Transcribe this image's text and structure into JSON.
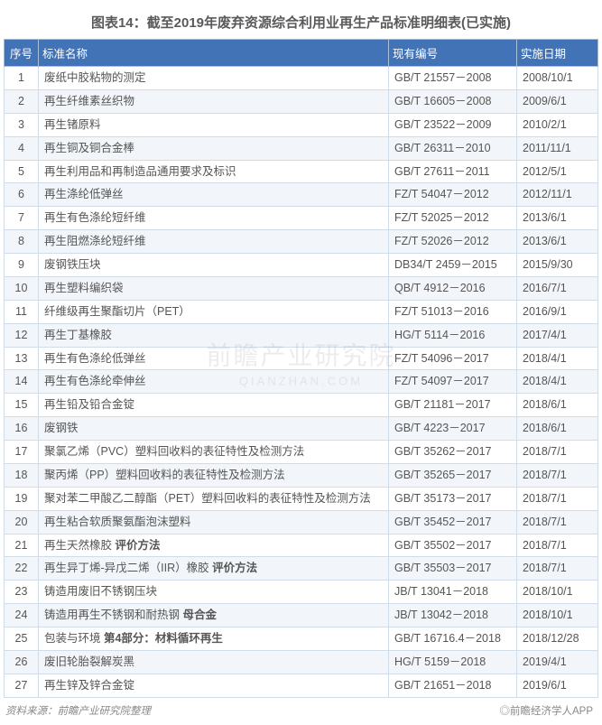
{
  "chart_data": {
    "type": "table",
    "title": "图表14：截至2019年废弃资源综合利用业再生产品标准明细表(已实施)",
    "columns": [
      "序号",
      "标准名称",
      "现有编号",
      "实施日期"
    ],
    "rows": [
      {
        "seq": "1",
        "name": "废纸中胶粘物的测定",
        "num": "GB/T 21557－2008",
        "date": "2008/10/1"
      },
      {
        "seq": "2",
        "name": "再生纤维素丝织物",
        "num": "GB/T 16605－2008",
        "date": "2009/6/1"
      },
      {
        "seq": "3",
        "name": "再生锗原料",
        "num": "GB/T 23522－2009",
        "date": "2010/2/1"
      },
      {
        "seq": "4",
        "name": "再生铜及铜合金棒",
        "num": "GB/T 26311－2010",
        "date": "2011/11/1"
      },
      {
        "seq": "5",
        "name": "再生利用品和再制造品通用要求及标识",
        "num": "GB/T 27611－2011",
        "date": "2012/5/1"
      },
      {
        "seq": "6",
        "name": "再生涤纶低弹丝",
        "num": "FZ/T 54047－2012",
        "date": "2012/11/1"
      },
      {
        "seq": "7",
        "name": "再生有色涤纶短纤维",
        "num": "FZ/T 52025－2012",
        "date": "2013/6/1"
      },
      {
        "seq": "8",
        "name": "再生阻燃涤纶短纤维",
        "num": "FZ/T 52026－2012",
        "date": "2013/6/1"
      },
      {
        "seq": "9",
        "name": "废钢铁压块",
        "num": "DB34/T 2459－2015",
        "date": "2015/9/30"
      },
      {
        "seq": "10",
        "name": "再生塑料编织袋",
        "num": "QB/T 4912－2016",
        "date": "2016/7/1"
      },
      {
        "seq": "11",
        "name": "纤维级再生聚酯切片（PET）",
        "num": "FZ/T 51013－2016",
        "date": "2016/9/1"
      },
      {
        "seq": "12",
        "name": "再生丁基橡胶",
        "num": "HG/T 5114－2016",
        "date": "2017/4/1"
      },
      {
        "seq": "13",
        "name": "再生有色涤纶低弹丝",
        "num": "FZ/T 54096－2017",
        "date": "2018/4/1"
      },
      {
        "seq": "14",
        "name": "再生有色涤纶牵伸丝",
        "num": "FZ/T 54097－2017",
        "date": "2018/4/1"
      },
      {
        "seq": "15",
        "name": "再生铅及铅合金锭",
        "num": "GB/T 21181－2017",
        "date": "2018/6/1"
      },
      {
        "seq": "16",
        "name": "废钢铁",
        "num": "GB/T 4223－2017",
        "date": "2018/6/1"
      },
      {
        "seq": "17",
        "name": "聚氯乙烯（PVC）塑料回收料的表征特性及检测方法",
        "num": "GB/T 35262－2017",
        "date": "2018/7/1"
      },
      {
        "seq": "18",
        "name": "聚丙烯（PP）塑料回收料的表征特性及检测方法",
        "num": "GB/T 35265－2017",
        "date": "2018/7/1"
      },
      {
        "seq": "19",
        "name": "聚对苯二甲酸乙二醇酯（PET）塑料回收料的表征特性及检测方法",
        "num": "GB/T 35173－2017",
        "date": "2018/7/1"
      },
      {
        "seq": "20",
        "name": "再生粘合软质聚氨酯泡沫塑料",
        "num": "GB/T 35452－2017",
        "date": "2018/7/1"
      },
      {
        "seq": "21",
        "name_pre": "再生天然橡胶 ",
        "name_bold": "评价方法",
        "name_post": "",
        "num": "GB/T 35502－2017",
        "date": "2018/7/1"
      },
      {
        "seq": "22",
        "name_pre": "再生异丁烯-异戊二烯（IIR）橡胶 ",
        "name_bold": "评价方法",
        "name_post": "",
        "num": "GB/T 35503－2017",
        "date": "2018/7/1"
      },
      {
        "seq": "23",
        "name": "铸造用废旧不锈钢压块",
        "num": "JB/T 13041－2018",
        "date": "2018/10/1"
      },
      {
        "seq": "24",
        "name_pre": "铸造用再生不锈钢和耐热钢 ",
        "name_bold": "母合金",
        "name_post": "",
        "num": "JB/T 13042－2018",
        "date": "2018/10/1"
      },
      {
        "seq": "25",
        "name_pre": "包装与环境 ",
        "name_bold": "第4部分：材料循环再生",
        "name_post": "",
        "num": "GB/T 16716.4－2018",
        "date": "2018/12/28"
      },
      {
        "seq": "26",
        "name": "废旧轮胎裂解炭黑",
        "num": "HG/T 5159－2018",
        "date": "2019/4/1"
      },
      {
        "seq": "27",
        "name": "再生锌及锌合金锭",
        "num": "GB/T 21651－2018",
        "date": "2019/6/1"
      }
    ]
  },
  "headers": {
    "seq": "序号",
    "name": "标准名称",
    "num": "现有编号",
    "date": "实施日期"
  },
  "footer": {
    "source": "资料来源：前瞻产业研究院整理",
    "brand": "◎前瞻经济学人APP"
  },
  "watermark": {
    "main": "前瞻产业研究院",
    "sub": "QIANZHAN.COM"
  }
}
